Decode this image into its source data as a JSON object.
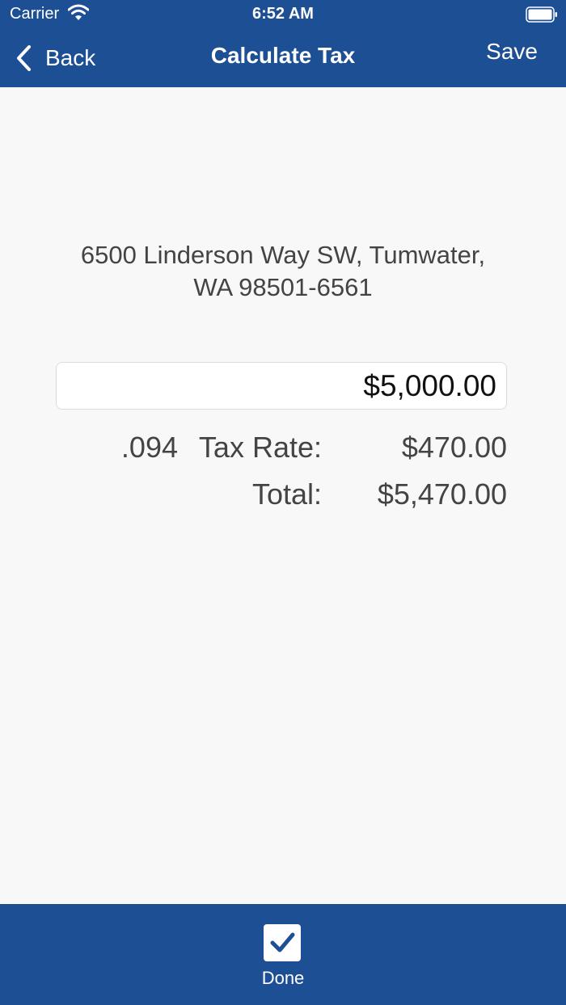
{
  "status_bar": {
    "carrier": "Carrier",
    "time": "6:52 AM",
    "wifi_icon": "wifi-icon",
    "battery_icon": "battery-icon"
  },
  "nav": {
    "back_label": "Back",
    "back_icon": "chevron-left-icon",
    "title": "Calculate Tax",
    "save_label": "Save"
  },
  "address": {
    "line1": "6500 Linderson Way SW, Tumwater,",
    "line2": "WA 98501-6561"
  },
  "amount_input": {
    "value": "$5,000.00"
  },
  "calculation": {
    "rate": ".094",
    "tax_rate_label": "Tax Rate:",
    "tax_amount": "$470.00",
    "total_label": "Total:",
    "total_amount": "$5,470.00"
  },
  "toolbar": {
    "done_label": "Done",
    "done_icon": "checkbox-checked-icon"
  },
  "colors": {
    "brand_blue": "#1d4f95",
    "background": "#f8f8f8",
    "text": "#444444"
  }
}
